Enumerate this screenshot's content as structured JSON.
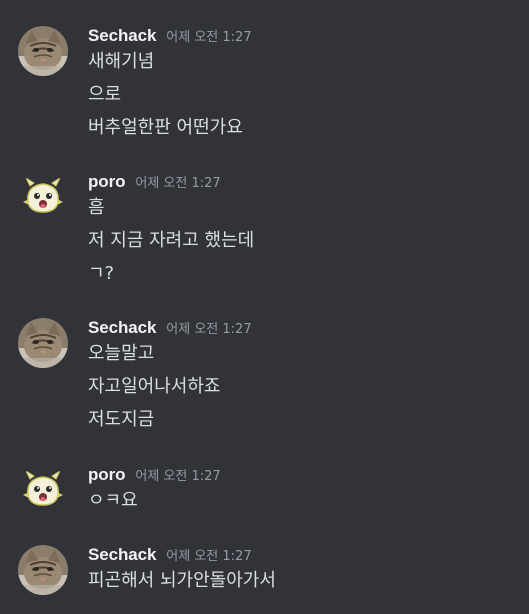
{
  "messages": [
    {
      "author": "Sechack",
      "avatar_icon": "cat-avatar-icon",
      "timestamp": "어제 오전 1:27",
      "lines": [
        "새해기념",
        "으로",
        "버추얼한판 어떤가요"
      ]
    },
    {
      "author": "poro",
      "avatar_icon": "poro-avatar-icon",
      "timestamp": "어제 오전 1:27",
      "lines": [
        "흠",
        "저 지금 자려고 했는데",
        "ㄱ?"
      ]
    },
    {
      "author": "Sechack",
      "avatar_icon": "cat-avatar-icon",
      "timestamp": "어제 오전 1:27",
      "lines": [
        "오늘말고",
        "자고일어나서하죠",
        "저도지금"
      ]
    },
    {
      "author": "poro",
      "avatar_icon": "poro-avatar-icon",
      "timestamp": "어제 오전 1:27",
      "lines": [
        "ㅇㅋ요"
      ]
    },
    {
      "author": "Sechack",
      "avatar_icon": "cat-avatar-icon",
      "timestamp": "어제 오전 1:27",
      "lines": [
        "피곤해서 뇌가안돌아가서"
      ]
    }
  ],
  "colors": {
    "background": "#313338",
    "username": "#f2f3f5",
    "timestamp": "#949ba4",
    "message_text": "#dbdee1"
  }
}
